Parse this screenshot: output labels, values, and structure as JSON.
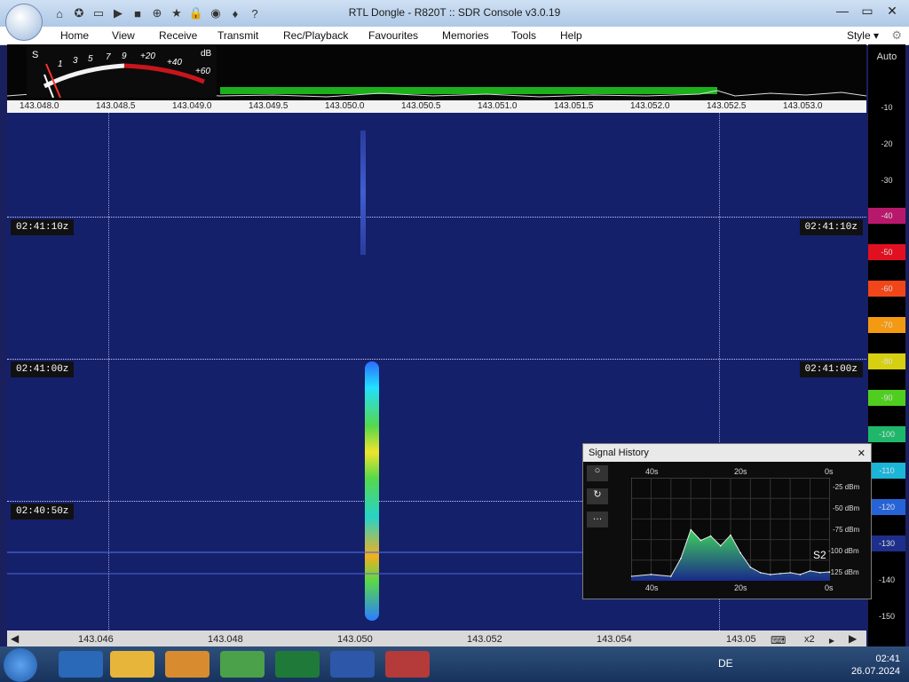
{
  "window": {
    "title": "RTL Dongle - R820T :: SDR Console v3.0.19",
    "controls": [
      "minimize",
      "maximize",
      "close"
    ]
  },
  "menu": {
    "items": [
      "Home",
      "View",
      "Receive",
      "Transmit",
      "Rec/Playback",
      "Favourites",
      "Memories",
      "Tools",
      "Help"
    ],
    "style_label": "Style"
  },
  "meter": {
    "labels": [
      "S",
      "1",
      "3",
      "5",
      "7",
      "9",
      "+20",
      "+40",
      "+60",
      "dB"
    ]
  },
  "frequency_ruler": {
    "labels": [
      "143.048.0",
      "143.048.5",
      "143.049.0",
      "143.049.5",
      "143.050.0",
      "143.050.5",
      "143.051.0",
      "143.051.5",
      "143.052.0",
      "143.052.5",
      "143.053.0"
    ]
  },
  "waterfall": {
    "timestamps": [
      "02:41:10z",
      "02:41:00z",
      "02:40:50z"
    ]
  },
  "db_scale": {
    "auto_label": "Auto",
    "marks": [
      "-10",
      "-20",
      "-30",
      "-40",
      "-50",
      "-60",
      "-70",
      "-80",
      "-90",
      "-100",
      "-110",
      "-120",
      "-130",
      "-140",
      "-150"
    ]
  },
  "bottom_ruler": {
    "labels": [
      "143.046",
      "143.048",
      "143.050",
      "143.052",
      "143.054",
      "143.05"
    ],
    "zoom": "x2"
  },
  "signal_history": {
    "title": "Signal History",
    "top_axis": [
      "40s",
      "20s",
      "0s"
    ],
    "bottom_axis": [
      "40s",
      "20s",
      "0s"
    ],
    "db_labels": [
      "-25 dBm",
      "-50 dBm",
      "-75 dBm",
      "-100 dBm",
      "-125 dBm"
    ],
    "s_label": "S2",
    "chart_data": {
      "type": "area",
      "xlabel": "",
      "ylabel": "",
      "x": [
        40,
        36,
        32,
        30,
        28,
        26,
        24,
        22,
        20,
        18,
        16,
        14,
        12,
        10,
        8,
        6,
        4,
        2,
        0
      ],
      "y": [
        -130,
        -128,
        -130,
        -110,
        -78,
        -90,
        -85,
        -96,
        -84,
        -104,
        -120,
        -126,
        -128,
        -127,
        -126,
        -128,
        -124,
        -126,
        -125
      ],
      "xlim": [
        40,
        0
      ],
      "ylim": [
        -135,
        -20
      ]
    }
  },
  "taskbar": {
    "lang": "DE",
    "time": "02:41",
    "date": "26.07.2024"
  }
}
